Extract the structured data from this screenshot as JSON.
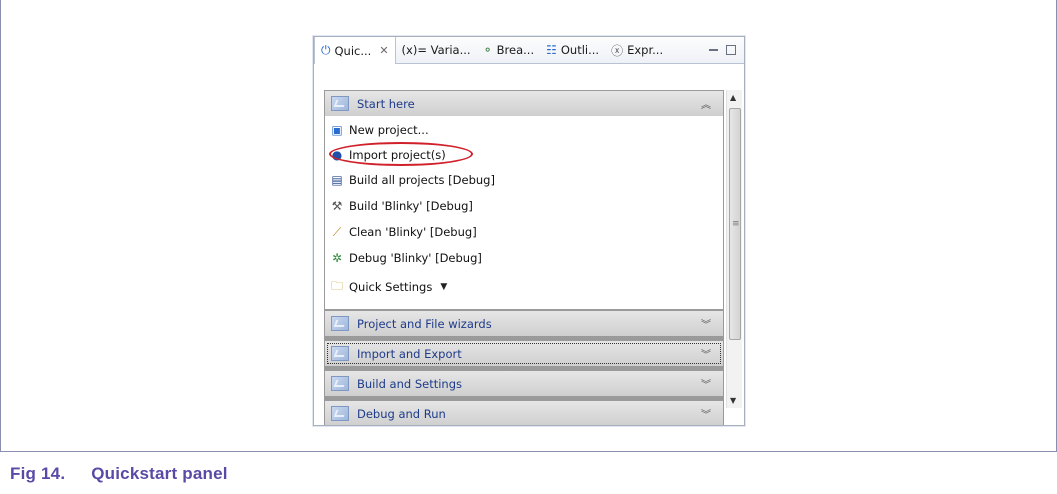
{
  "caption": {
    "number": "Fig 14.",
    "title": "Quickstart panel"
  },
  "tabs": [
    {
      "icon": "power-icon",
      "label": "Quic...",
      "active": true
    },
    {
      "icon": "variables-icon",
      "label": "(x)= Varia..."
    },
    {
      "icon": "breakpoints-icon",
      "label": "Brea..."
    },
    {
      "icon": "outline-icon",
      "label": "Outli..."
    },
    {
      "icon": "expressions-icon",
      "label": "Expr..."
    }
  ],
  "sections": {
    "start_here": "Start here",
    "project_wizards": "Project and File wizards",
    "import_export": "Import and Export",
    "build_settings": "Build and Settings",
    "debug_run": "Debug and Run"
  },
  "items": {
    "new_project": "New project...",
    "import_projects": "Import project(s)",
    "build_all": "Build all projects [Debug]",
    "build_blinky": "Build 'Blinky' [Debug]",
    "clean_blinky": "Clean 'Blinky' [Debug]",
    "debug_blinky": "Debug 'Blinky' [Debug]",
    "quick_settings": "Quick Settings"
  },
  "colors": {
    "highlight": "#d0202a",
    "section_text": "#1e3b8a",
    "caption": "#5a4aa6"
  }
}
